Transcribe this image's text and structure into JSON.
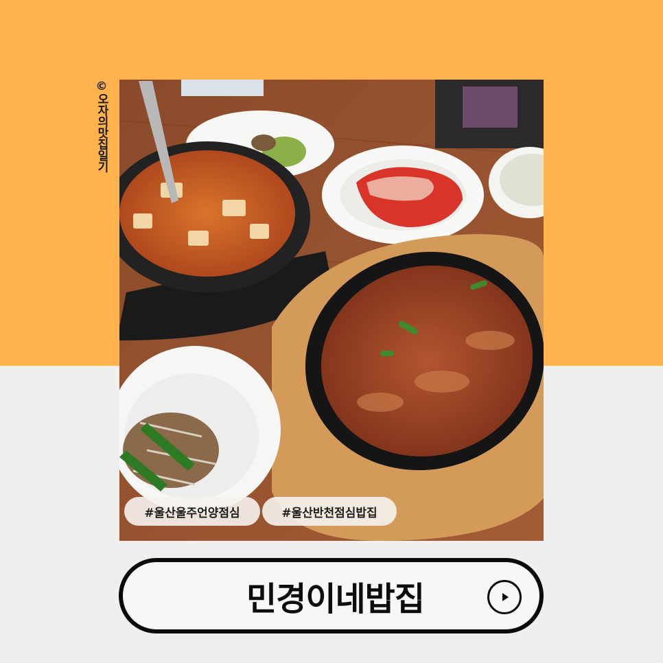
{
  "credit": "©오자의맛집일기",
  "photo": {
    "alt": "",
    "hashtags": [
      "#울산울주언양점심",
      "#울산반천점심밥집"
    ]
  },
  "title": "민경이네밥집",
  "play_icon": "play-icon",
  "colors": {
    "top_background": "#ffb24e",
    "bottom_background": "#efefef",
    "pill_border": "#0a0a0a"
  }
}
